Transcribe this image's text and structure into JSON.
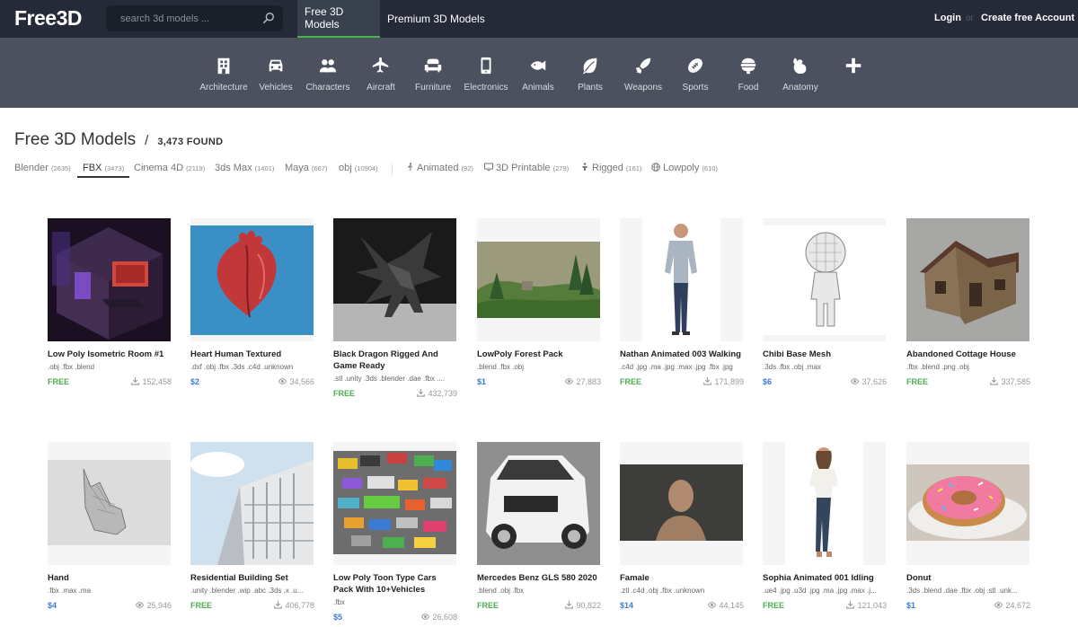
{
  "header": {
    "logo": "Free3D",
    "search_placeholder": "search 3d models ...",
    "tabs": [
      "Free 3D Models",
      "Premium 3D Models"
    ],
    "login": "Login",
    "or": "or",
    "create": "Create free Account"
  },
  "categories": [
    {
      "label": "Architecture",
      "icon": "building-icon"
    },
    {
      "label": "Vehicles",
      "icon": "car-icon"
    },
    {
      "label": "Characters",
      "icon": "people-icon"
    },
    {
      "label": "Aircraft",
      "icon": "plane-icon"
    },
    {
      "label": "Furniture",
      "icon": "sofa-icon"
    },
    {
      "label": "Electronics",
      "icon": "phone-icon"
    },
    {
      "label": "Animals",
      "icon": "fish-icon"
    },
    {
      "label": "Plants",
      "icon": "leaf-icon"
    },
    {
      "label": "Weapons",
      "icon": "rocket-icon"
    },
    {
      "label": "Sports",
      "icon": "football-icon"
    },
    {
      "label": "Food",
      "icon": "food-icon"
    },
    {
      "label": "Anatomy",
      "icon": "anatomy-icon"
    },
    {
      "label": "",
      "icon": "plus-icon"
    }
  ],
  "heading": {
    "title": "Free 3D Models",
    "slash": "/",
    "found": "3,473 FOUND"
  },
  "filters": {
    "formats": [
      {
        "label": "Blender",
        "count": "(2635)"
      },
      {
        "label": "FBX",
        "count": "(3473)"
      },
      {
        "label": "Cinema 4D",
        "count": "(2119)"
      },
      {
        "label": "3ds Max",
        "count": "(1401)"
      },
      {
        "label": "Maya",
        "count": "(667)"
      },
      {
        "label": "obj",
        "count": "(10904)"
      }
    ],
    "tags": [
      {
        "label": "Animated",
        "count": "(92)"
      },
      {
        "label": "3D Printable",
        "count": "(279)"
      },
      {
        "label": "Rigged",
        "count": "(161)"
      },
      {
        "label": "Lowpoly",
        "count": "(610)"
      }
    ]
  },
  "models": [
    {
      "title": "Low Poly Isometric Room #1",
      "formats": ".obj .fbx .blend",
      "price": "FREE",
      "stat": "152,458",
      "stat_icon": "download-icon"
    },
    {
      "title": "Heart Human Textured",
      "formats": ".dxf .obj .fbx .3ds .c4d .unknown",
      "price": "$2",
      "stat": "34,566",
      "stat_icon": "eye-icon"
    },
    {
      "title": "Black Dragon Rigged And Game Ready",
      "formats": ".stl .unity .3ds .blender .dae .fbx ....",
      "price": "FREE",
      "stat": "432,739",
      "stat_icon": "download-icon"
    },
    {
      "title": "LowPoly Forest Pack",
      "formats": ".blend .fbx .obj",
      "price": "$1",
      "stat": "27,883",
      "stat_icon": "eye-icon"
    },
    {
      "title": "Nathan Animated 003 Walking",
      "formats": ".c4d .jpg .ma .jpg .max .jpg .fbx .jpg",
      "price": "FREE",
      "stat": "171,899",
      "stat_icon": "download-icon"
    },
    {
      "title": "Chibi Base Mesh",
      "formats": ".3ds .fbx .obj .max",
      "price": "$6",
      "stat": "37,626",
      "stat_icon": "eye-icon"
    },
    {
      "title": "Abandoned Cottage House",
      "formats": ".fbx .blend .png .obj",
      "price": "FREE",
      "stat": "337,585",
      "stat_icon": "download-icon"
    },
    {
      "title": "Hand",
      "formats": ".fbx .max .ma",
      "price": "$4",
      "stat": "25,946",
      "stat_icon": "eye-icon"
    },
    {
      "title": "Residential Building Set",
      "formats": ".unity .blender .wip .abc .3ds .x .u...",
      "price": "FREE",
      "stat": "406,778",
      "stat_icon": "download-icon"
    },
    {
      "title": "Low Poly Toon Type Cars Pack With 10+Vehicles",
      "formats": ".fbx",
      "price": "$5",
      "stat": "26,608",
      "stat_icon": "eye-icon"
    },
    {
      "title": "Mercedes Benz GLS 580 2020",
      "formats": ".blend .obj .fbx",
      "price": "FREE",
      "stat": "90,822",
      "stat_icon": "download-icon"
    },
    {
      "title": "Famale",
      "formats": ".ztl .c4d .obj .fbx .unknown",
      "price": "$14",
      "stat": "44,145",
      "stat_icon": "eye-icon"
    },
    {
      "title": "Sophia Animated 001 Idling",
      "formats": ".ue4 .jpg .u3d .jpg .ma .jpg .max .j...",
      "price": "FREE",
      "stat": "121,043",
      "stat_icon": "download-icon"
    },
    {
      "title": "Donut",
      "formats": ".3ds .blend .dae .fbx .obj .stl .unk...",
      "price": "$1",
      "stat": "24,672",
      "stat_icon": "eye-icon"
    }
  ]
}
